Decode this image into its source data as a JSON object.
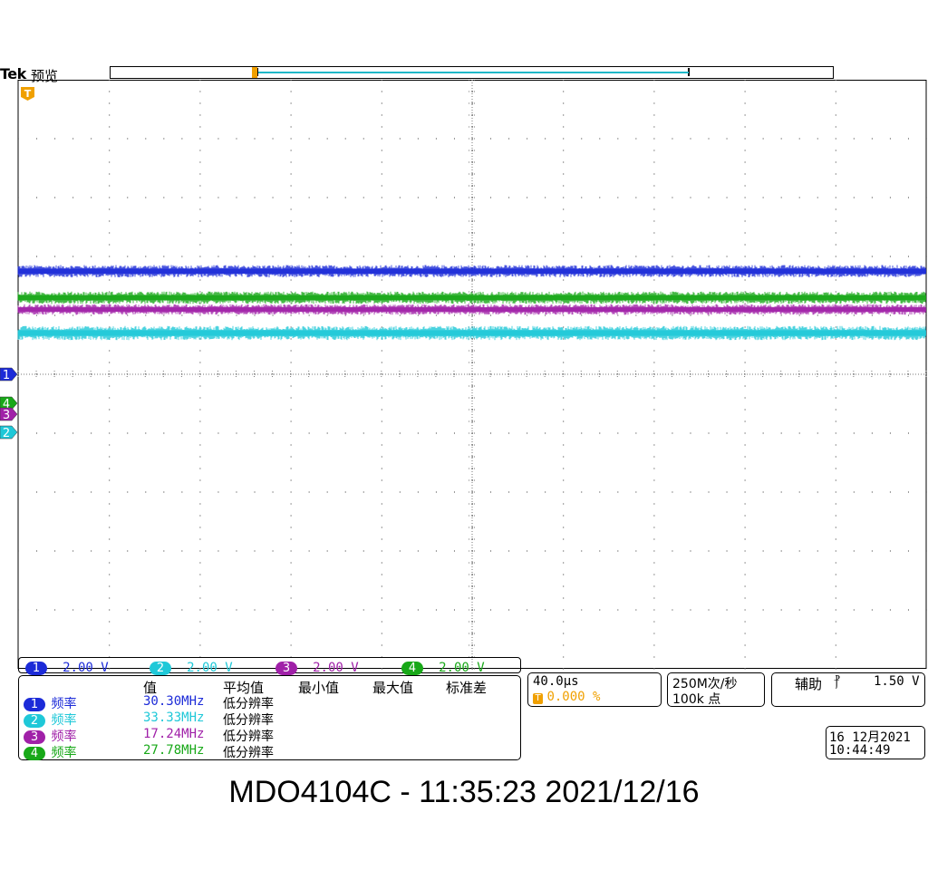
{
  "header": {
    "brand": "Tek",
    "state": "预览"
  },
  "colors": {
    "ch1": "#1c2bd8",
    "ch2": "#1fc8d8",
    "ch3": "#a020a8",
    "ch4": "#18a818",
    "trigger": "#f0a000",
    "grid": "#808080"
  },
  "markers": {
    "trigger_marker": "T",
    "ch1": "1",
    "ch2": "2",
    "ch3": "3",
    "ch4": "4"
  },
  "channels": [
    {
      "id": "1",
      "scale": "2.00 V"
    },
    {
      "id": "2",
      "scale": "2.00 V"
    },
    {
      "id": "3",
      "scale": "2.00 V"
    },
    {
      "id": "4",
      "scale": "2.00 V"
    }
  ],
  "measurements": {
    "headers": [
      "值",
      "平均值",
      "最小值",
      "最大值",
      "标准差"
    ],
    "rows": [
      {
        "ch": "1",
        "label": "频率",
        "value": "30.30MHz",
        "note": "低分辨率"
      },
      {
        "ch": "2",
        "label": "频率",
        "value": "33.33MHz",
        "note": "低分辨率"
      },
      {
        "ch": "3",
        "label": "频率",
        "value": "17.24MHz",
        "note": "低分辨率"
      },
      {
        "ch": "4",
        "label": "频率",
        "value": "27.78MHz",
        "note": "低分辨率"
      }
    ]
  },
  "timebase": {
    "scale": "40.0µs",
    "trigger_position": "0.000 %"
  },
  "acquisition": {
    "sample_rate": "250M次/秒",
    "record_length": "100k 点"
  },
  "trigger": {
    "source": "辅助",
    "slope_icon": "falling-edge-icon",
    "slope_glyph": "⳨",
    "level": "1.50 V"
  },
  "clock": {
    "date": "16 12月2021",
    "time": "10:44:49"
  },
  "footer": {
    "caption": "MDO4104C - 11:35:23   2021/12/16"
  },
  "waveforms": [
    {
      "channel": "1",
      "level_div": 1.75,
      "noise_div": 0.07
    },
    {
      "channel": "4",
      "level_div": 1.3,
      "noise_div": 0.07
    },
    {
      "channel": "3",
      "level_div": 1.1,
      "noise_div": 0.06
    },
    {
      "channel": "2",
      "level_div": 0.7,
      "noise_div": 0.08
    }
  ]
}
